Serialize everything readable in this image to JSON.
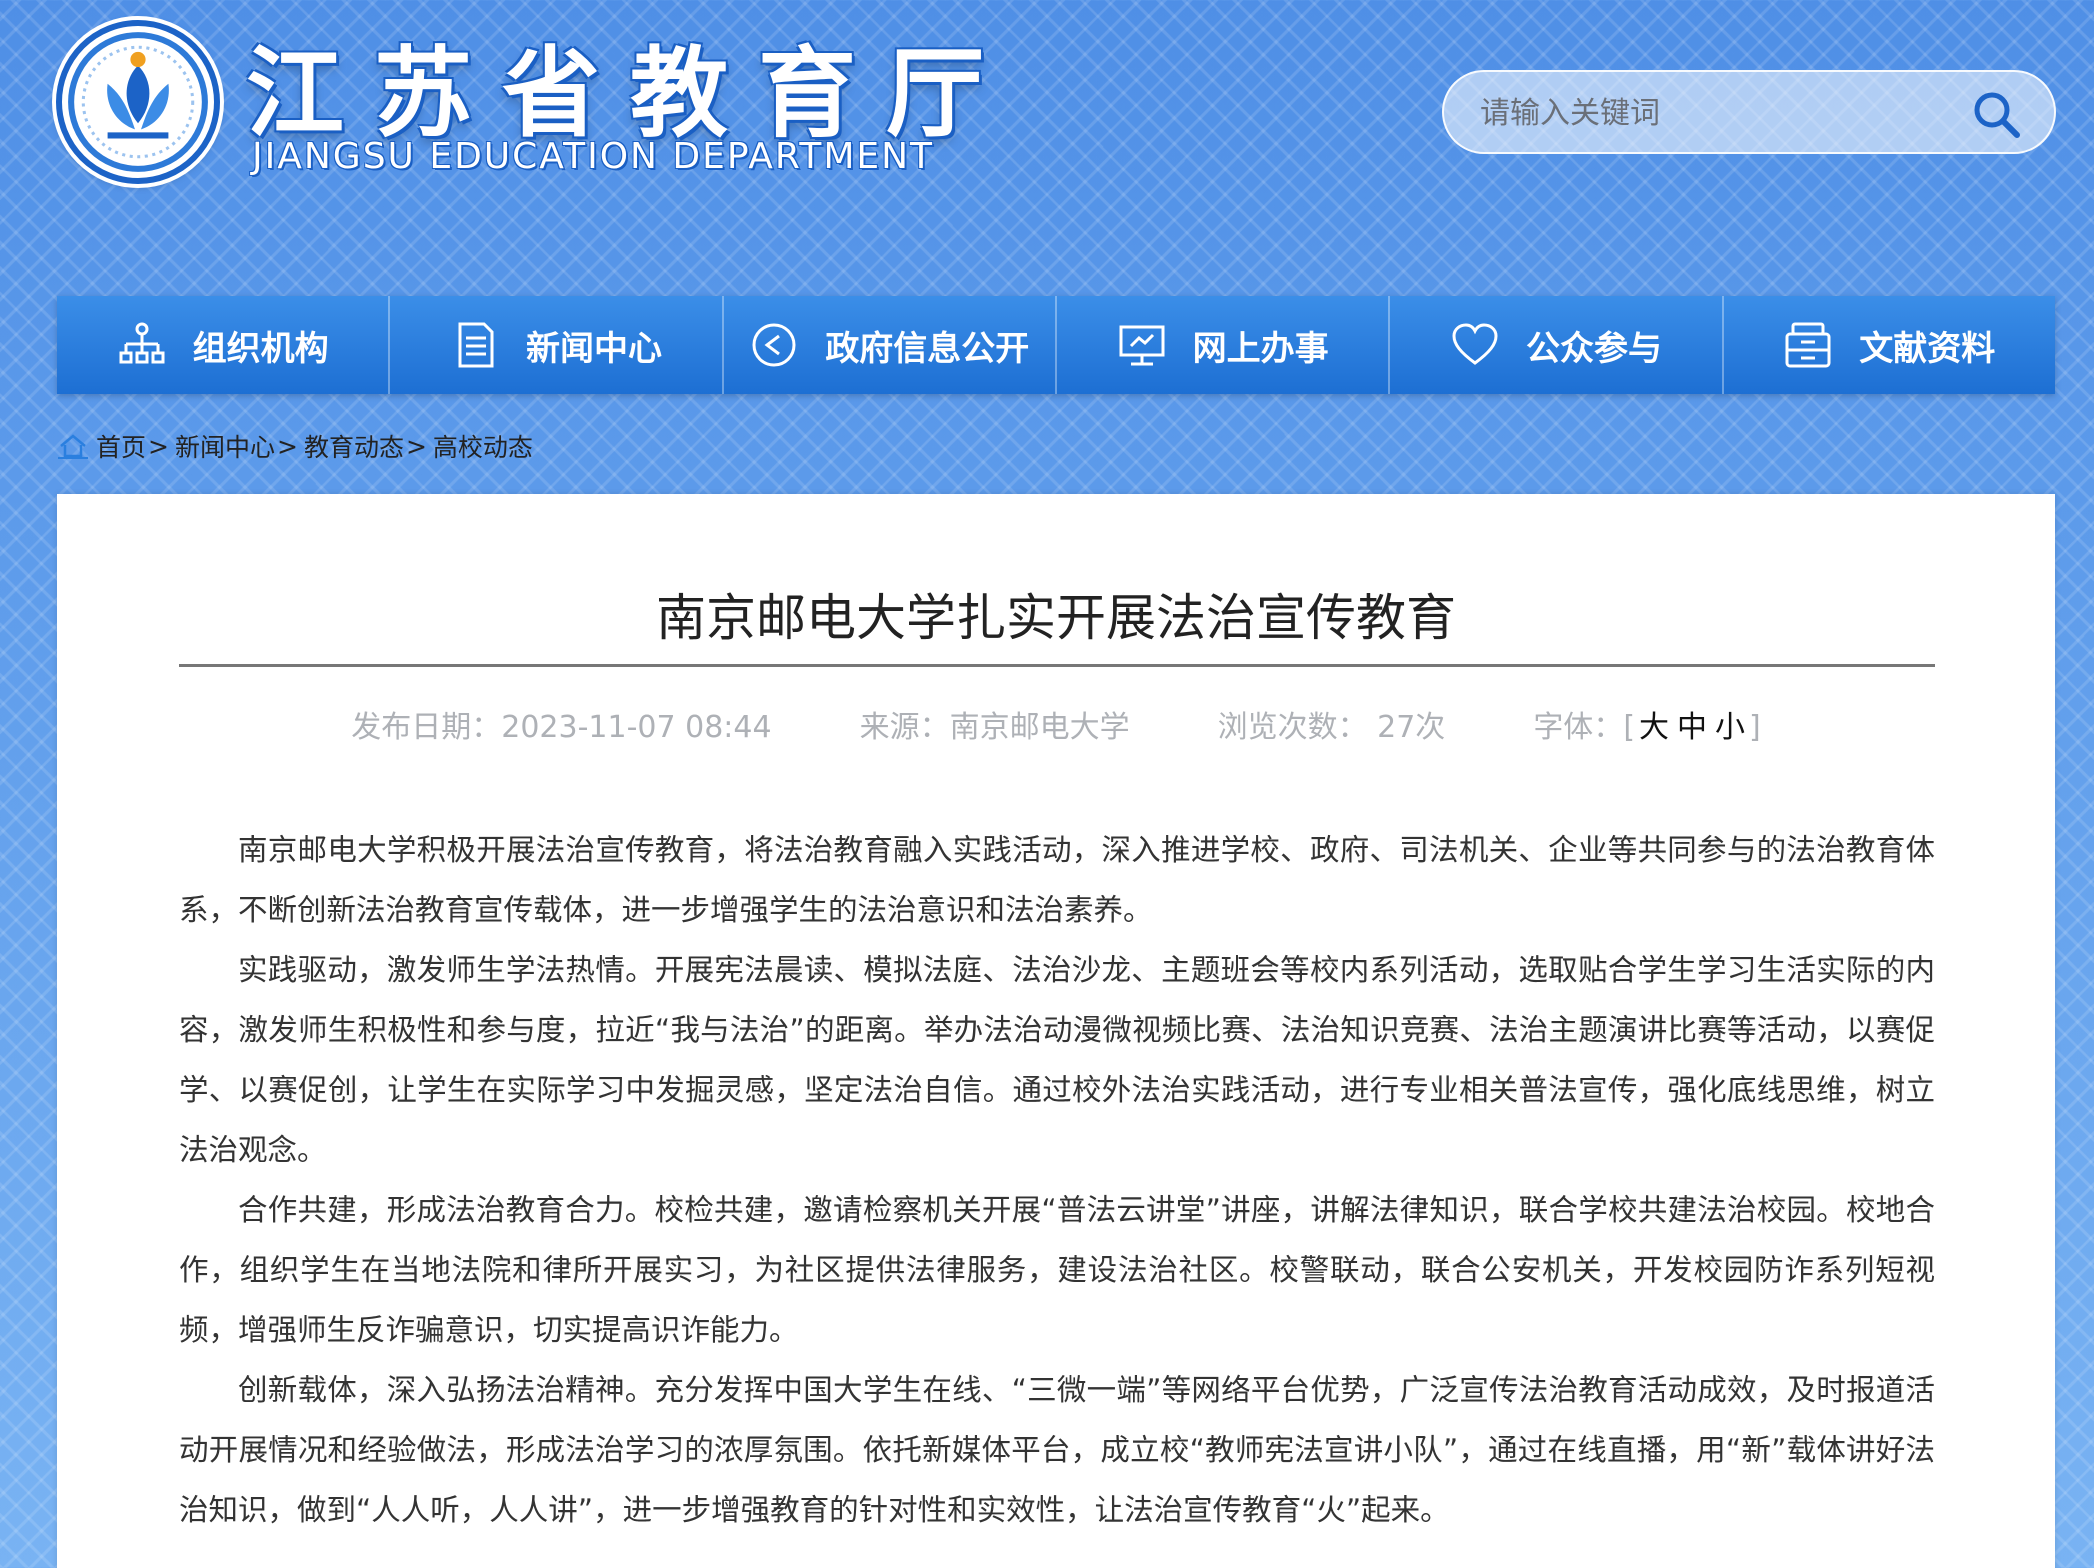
{
  "header": {
    "title": "江苏省教育厅",
    "subtitle": "JIANGSU EDUCATION DEPARTMENT",
    "search_placeholder": "请输入关键词"
  },
  "nav": {
    "items": [
      {
        "label": "组织机构",
        "icon": "org-chart-icon"
      },
      {
        "label": "新闻中心",
        "icon": "document-icon"
      },
      {
        "label": "政府信息公开",
        "icon": "play-circle-icon"
      },
      {
        "label": "网上办事",
        "icon": "monitor-icon"
      },
      {
        "label": "公众参与",
        "icon": "heart-icon"
      },
      {
        "label": "文献资料",
        "icon": "archive-icon"
      }
    ]
  },
  "breadcrumb": {
    "items": [
      "首页",
      "新闻中心",
      "教育动态",
      "高校动态"
    ],
    "separator": ">"
  },
  "article": {
    "title": "南京邮电大学扎实开展法治宣传教育",
    "meta": {
      "date": "发布日期：2023-11-07 08:44",
      "source": "来源：南京邮电大学",
      "views": "浏览次数： 27次",
      "font_label": "字体：",
      "font_sizes": [
        "大",
        "中",
        "小"
      ]
    },
    "paragraphs": [
      "南京邮电大学积极开展法治宣传教育，将法治教育融入实践活动，深入推进学校、政府、司法机关、企业等共同参与的法治教育体系，不断创新法治教育宣传载体，进一步增强学生的法治意识和法治素养。",
      "实践驱动，激发师生学法热情。开展宪法晨读、模拟法庭、法治沙龙、主题班会等校内系列活动，选取贴合学生学习生活实际的内容，激发师生积极性和参与度，拉近“我与法治”的距离。举办法治动漫微视频比赛、法治知识竞赛、法治主题演讲比赛等活动，以赛促学、以赛促创，让学生在实际学习中发掘灵感，坚定法治自信。通过校外法治实践活动，进行专业相关普法宣传，强化底线思维，树立法治观念。",
      "合作共建，形成法治教育合力。校检共建，邀请检察机关开展“普法云讲堂”讲座，讲解法律知识，联合学校共建法治校园。校地合作，组织学生在当地法院和律所开展实习，为社区提供法律服务，建设法治社区。校警联动，联合公安机关，开发校园防诈系列短视频，增强师生反诈骗意识，切实提高识诈能力。",
      "创新载体，深入弘扬法治精神。充分发挥中国大学生在线、“三微一端”等网络平台优势，广泛宣传法治教育活动成效，及时报道活动开展情况和经验做法，形成法治学习的浓厚氛围。依托新媒体平台，成立校“教师宪法宣讲小队”，通过在线直播，用“新”载体讲好法治知识，做到“人人听，人人讲”，进一步增强教育的针对性和实效性，让法治宣传教育“火”起来。"
    ]
  },
  "colors": {
    "nav_bg": "#2a7fdf",
    "header_text_shadow": "#1a5fc4",
    "meta_text": "#aeb1b6"
  }
}
